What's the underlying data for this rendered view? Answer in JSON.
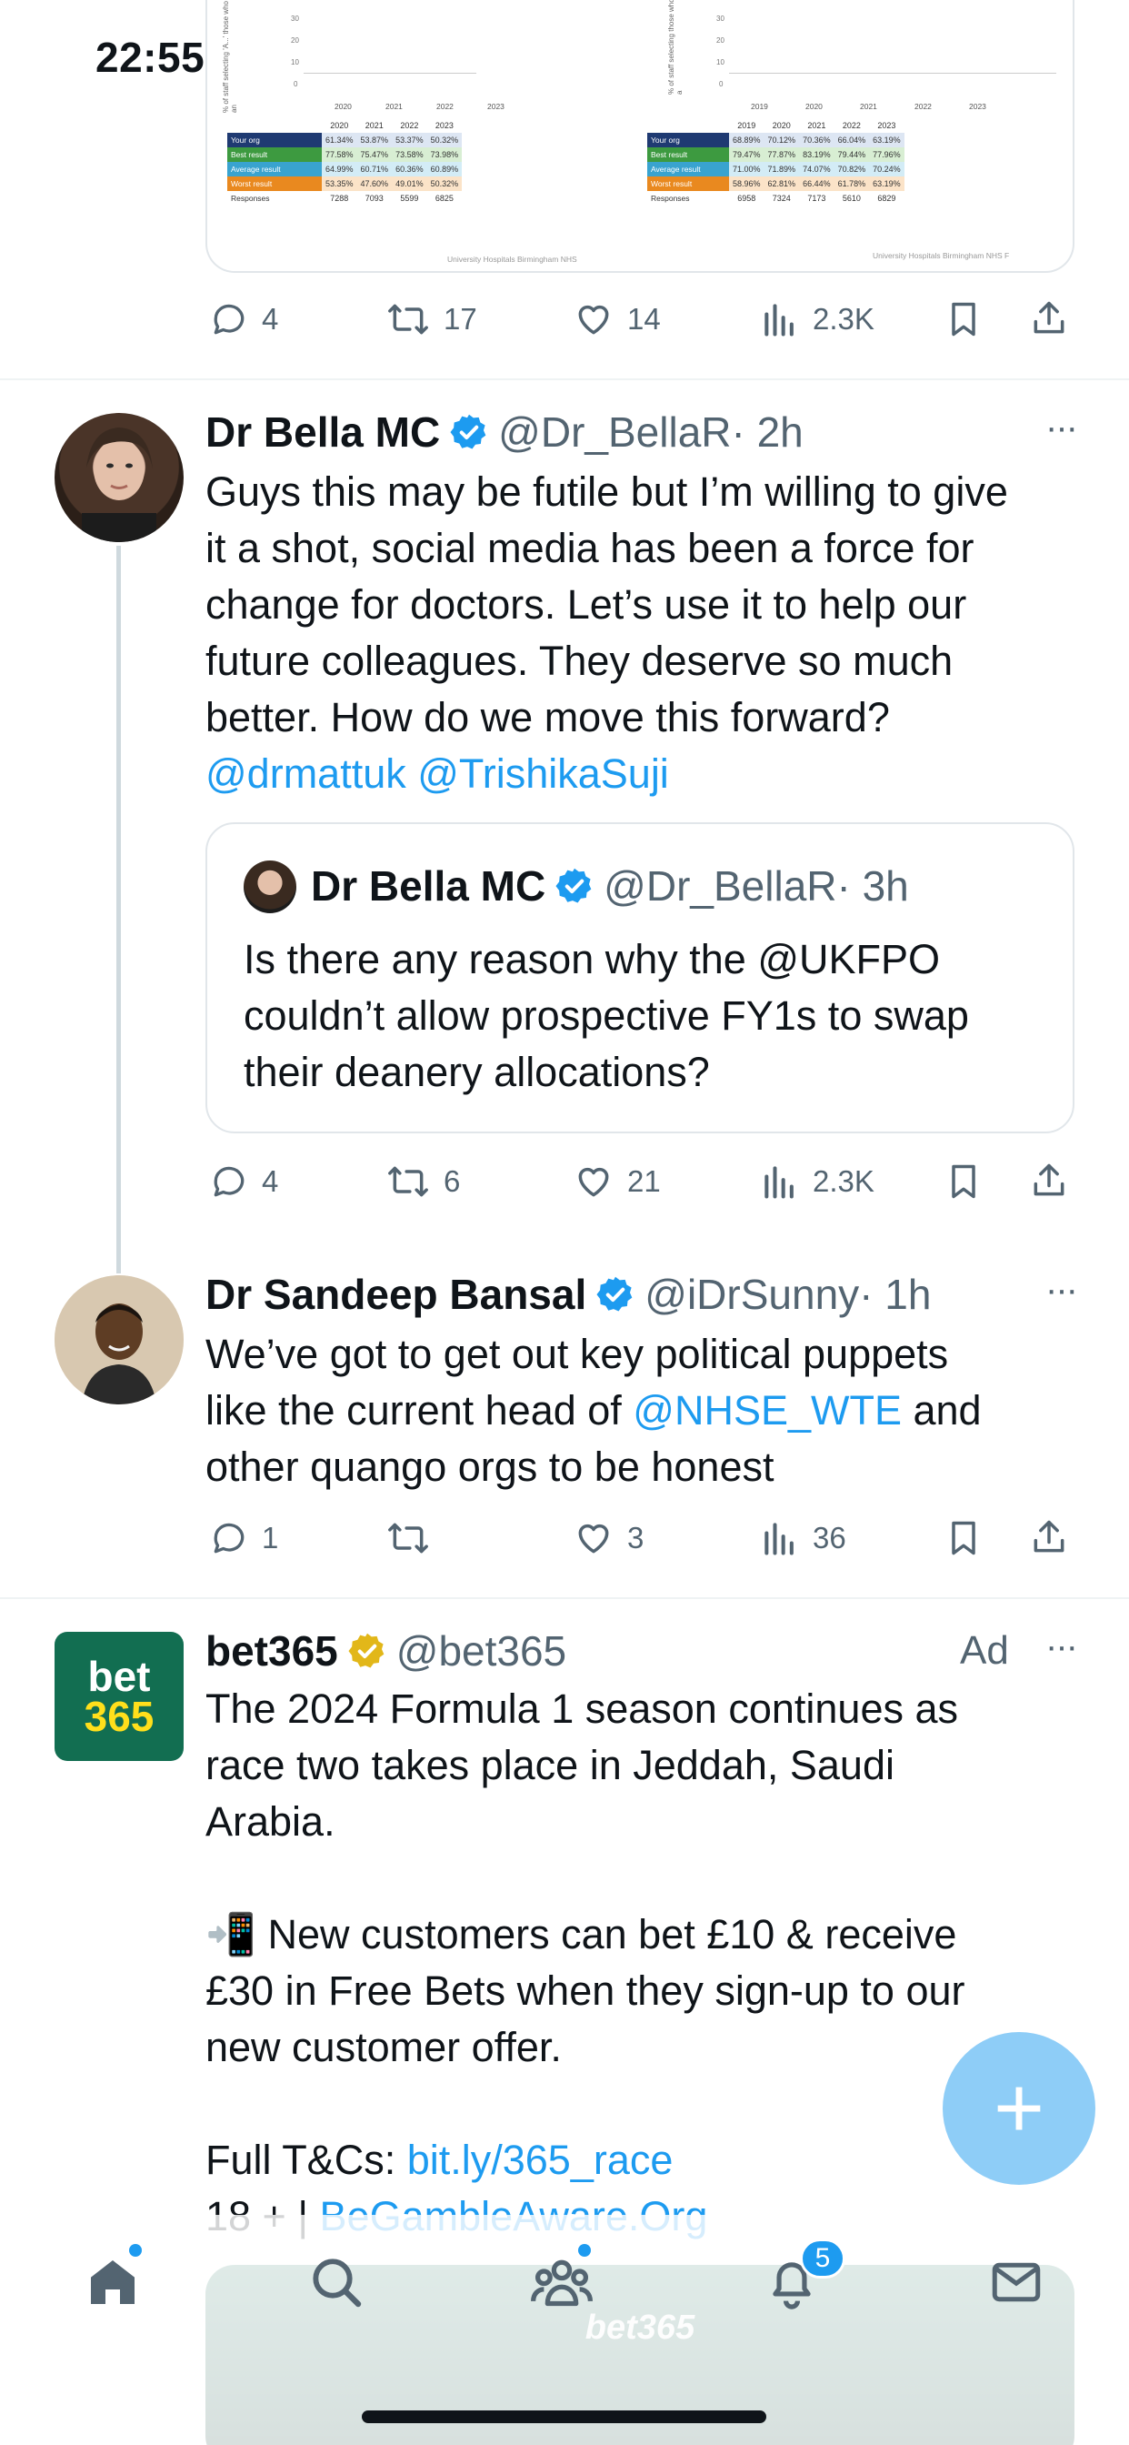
{
  "status_bar": {
    "time": "22:55"
  },
  "chart_tweet": {
    "left_table": {
      "axis_label": "% of staff selecting 'A...' those who an",
      "yticks": [
        "30",
        "20",
        "10",
        "0"
      ],
      "years": [
        "2020",
        "2021",
        "2022",
        "2023"
      ],
      "rows": [
        {
          "label": "Your org",
          "values": [
            "61.34%",
            "53.87%",
            "53.37%",
            "50.32%"
          ]
        },
        {
          "label": "Best result",
          "values": [
            "77.58%",
            "75.47%",
            "73.58%",
            "73.98%"
          ]
        },
        {
          "label": "Average result",
          "values": [
            "64.99%",
            "60.71%",
            "60.36%",
            "60.89%"
          ]
        },
        {
          "label": "Worst result",
          "values": [
            "53.35%",
            "47.60%",
            "49.01%",
            "50.32%"
          ]
        },
        {
          "label": "Responses",
          "values": [
            "7288",
            "7093",
            "5599",
            "6825"
          ]
        }
      ],
      "footer": "University Hospitals Birmingham NHS"
    },
    "right_table": {
      "axis_label": "% of staff selecting those who a",
      "yticks": [
        "30",
        "20",
        "10",
        "0"
      ],
      "years": [
        "2019",
        "2020",
        "2021",
        "2022",
        "2023"
      ],
      "rows": [
        {
          "label": "Your org",
          "values": [
            "68.89%",
            "70.12%",
            "70.36%",
            "66.04%",
            "63.19%"
          ]
        },
        {
          "label": "Best result",
          "values": [
            "79.47%",
            "77.87%",
            "83.19%",
            "79.44%",
            "77.96%"
          ]
        },
        {
          "label": "Average result",
          "values": [
            "71.00%",
            "71.89%",
            "74.07%",
            "70.82%",
            "70.24%"
          ]
        },
        {
          "label": "Worst result",
          "values": [
            "58.96%",
            "62.81%",
            "66.44%",
            "61.78%",
            "63.19%"
          ]
        },
        {
          "label": "Responses",
          "values": [
            "6958",
            "7324",
            "7173",
            "5610",
            "6829"
          ]
        }
      ],
      "footer": "University Hospitals Birmingham NHS F"
    },
    "actions": {
      "replies": "4",
      "reposts": "17",
      "likes": "14",
      "views": "2.3K"
    }
  },
  "tweet1": {
    "name": "Dr Bella MC",
    "handle": "@Dr_BellaR",
    "time": "· 2h",
    "more": "···",
    "lines": [
      "Guys this may be futile but I’m willing to give",
      "it a shot, social media has been a force for",
      "change for doctors. Let’s use it to help our",
      "future colleagues. They deserve so much",
      "better. How do we move this forward?"
    ],
    "mentions": "@drmattuk @TrishikaSuji",
    "quote": {
      "name": "Dr Bella MC",
      "handle": "@Dr_BellaR",
      "time": "· 3h",
      "lines": [
        "Is there any reason why the @UKFPO",
        "couldn’t allow prospective FY1s to swap",
        "their deanery allocations?"
      ]
    },
    "actions": {
      "replies": "4",
      "reposts": "6",
      "likes": "21",
      "views": "2.3K"
    }
  },
  "tweet2": {
    "name": "Dr Sandeep Bansal",
    "handle": "@iDrSunny",
    "time": "· 1h",
    "more": "···",
    "line1": "We’ve got to get out key political puppets",
    "line2_pre": "like the current head of ",
    "line2_link": "@NHSE_WTE",
    "line2_post": " and",
    "line3": "other quango orgs to be honest",
    "actions": {
      "replies": "1",
      "reposts": "",
      "likes": "3",
      "views": "36"
    }
  },
  "ad": {
    "name": "bet365",
    "handle": "@bet365",
    "ad_label": "Ad",
    "more": "···",
    "logo_top": "bet",
    "logo_bottom": "365",
    "lines": [
      "The 2024 Formula 1 season continues as",
      "race two takes place in Jeddah, Saudi",
      "Arabia."
    ],
    "offer_emoji": "📲",
    "offer_lines": [
      " New customers can bet £10 & receive",
      "£30 in Free Bets when they sign-up to our",
      "new customer offer."
    ],
    "tc_label": "Full T&Cs: ",
    "tc_link": "bit.ly/365_race",
    "age_label": "18 + | ",
    "gamble_link": "BeGambleAware.Org",
    "image_text": "bet365"
  },
  "fab": {
    "label": "+"
  },
  "nav": {
    "notifications_badge": "5"
  },
  "colors": {
    "accent": "#1d9bf0",
    "verified": "#1d9bf0",
    "gold": "#e2b719",
    "bet365_green": "#126e51",
    "bet365_yellow": "#ffdf1b"
  }
}
